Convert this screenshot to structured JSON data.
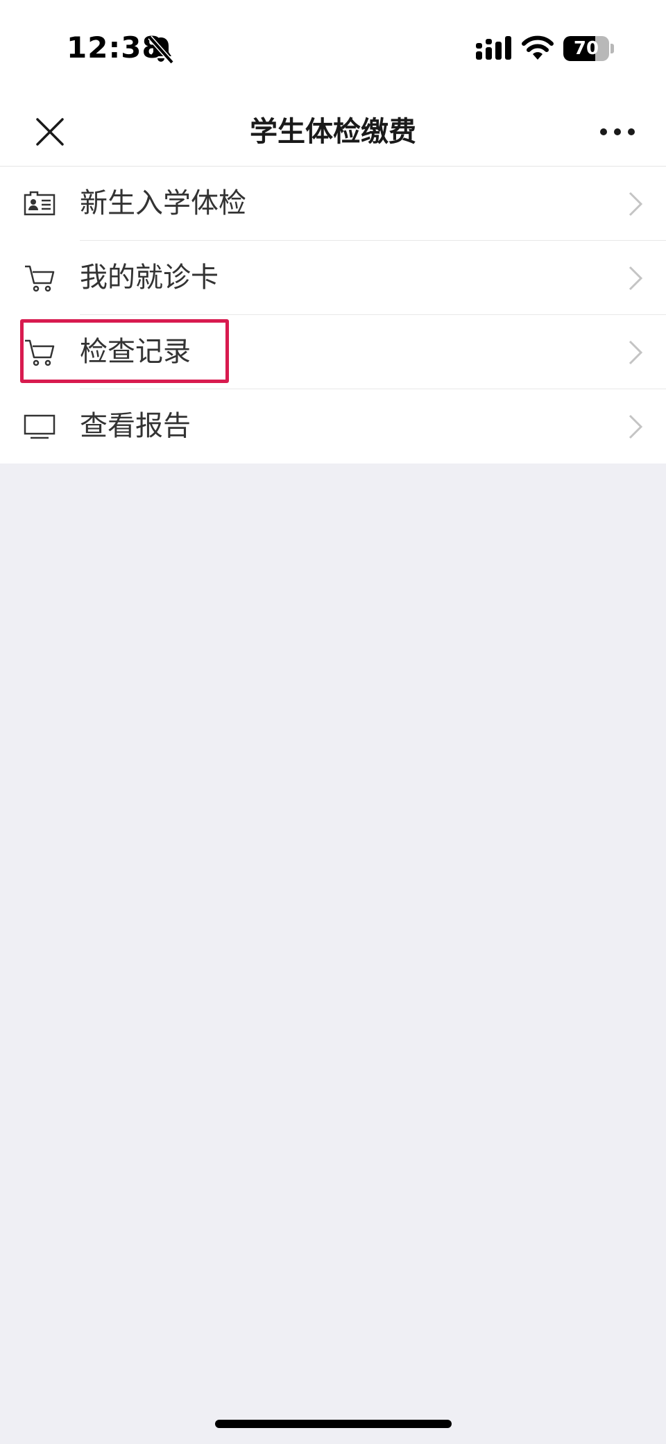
{
  "status_bar": {
    "time": "12:38",
    "battery_level": "70",
    "battery_fraction": 0.7,
    "icons": [
      "bell-slash-icon",
      "signal-icon",
      "wifi-icon",
      "battery-icon"
    ]
  },
  "nav": {
    "title": "学生体检缴费",
    "close_icon": "close-icon",
    "more_icon": "more-icon"
  },
  "menu": {
    "items": [
      {
        "label": "新生入学体检",
        "icon": "id-card-icon"
      },
      {
        "label": "我的就诊卡",
        "icon": "cart-icon"
      },
      {
        "label": "检查记录",
        "icon": "cart-icon",
        "highlighted": true
      },
      {
        "label": "查看报告",
        "icon": "monitor-icon"
      }
    ]
  },
  "colors": {
    "highlight": "#d81b4f",
    "background": "#efeff4",
    "text": "#333333"
  }
}
